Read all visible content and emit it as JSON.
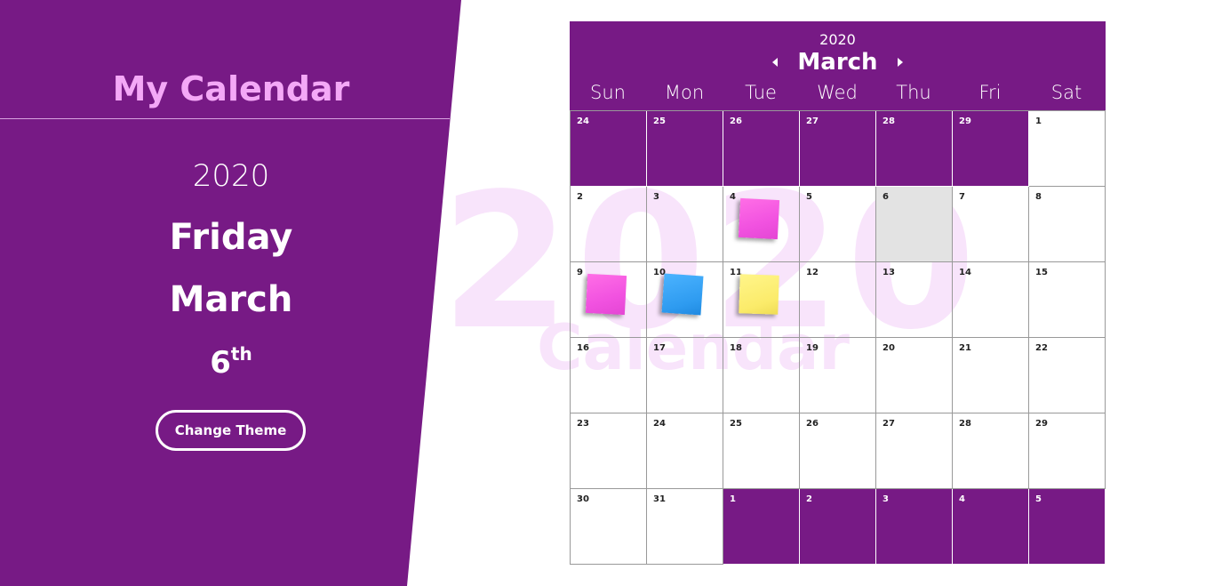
{
  "sidebar": {
    "title": "My Calendar",
    "year": "2020",
    "weekday": "Friday",
    "month": "March",
    "day": "6",
    "day_suffix": "th",
    "theme_button": "Change Theme"
  },
  "watermark": {
    "year": "2020",
    "subtitle": "Calendar"
  },
  "calendar": {
    "year": "2020",
    "month": "March",
    "weekdays": [
      "Sun",
      "Mon",
      "Tue",
      "Wed",
      "Thu",
      "Fri",
      "Sat"
    ],
    "days": [
      {
        "n": "24",
        "other": true
      },
      {
        "n": "25",
        "other": true
      },
      {
        "n": "26",
        "other": true
      },
      {
        "n": "27",
        "other": true
      },
      {
        "n": "28",
        "other": true
      },
      {
        "n": "29",
        "other": true
      },
      {
        "n": "1"
      },
      {
        "n": "2"
      },
      {
        "n": "3"
      },
      {
        "n": "4",
        "note": "pink"
      },
      {
        "n": "5"
      },
      {
        "n": "6",
        "today": true
      },
      {
        "n": "7"
      },
      {
        "n": "8"
      },
      {
        "n": "9",
        "note": "pink"
      },
      {
        "n": "10",
        "note": "blue"
      },
      {
        "n": "11",
        "note": "yellow"
      },
      {
        "n": "12"
      },
      {
        "n": "13"
      },
      {
        "n": "14"
      },
      {
        "n": "15"
      },
      {
        "n": "16"
      },
      {
        "n": "17"
      },
      {
        "n": "18"
      },
      {
        "n": "19"
      },
      {
        "n": "20"
      },
      {
        "n": "21"
      },
      {
        "n": "22"
      },
      {
        "n": "23"
      },
      {
        "n": "24"
      },
      {
        "n": "25"
      },
      {
        "n": "26"
      },
      {
        "n": "27"
      },
      {
        "n": "28"
      },
      {
        "n": "29"
      },
      {
        "n": "30"
      },
      {
        "n": "31"
      },
      {
        "n": "1",
        "other": true
      },
      {
        "n": "2",
        "other": true
      },
      {
        "n": "3",
        "other": true
      },
      {
        "n": "4",
        "other": true
      },
      {
        "n": "5",
        "other": true
      }
    ]
  },
  "colors": {
    "primary": "#771a85",
    "title_accent": "#f4a8f7",
    "watermark": "#f8e4fb",
    "today": "#e3e3e3",
    "note_pink": "#f152e0",
    "note_blue": "#2e9bf0",
    "note_yellow": "#fbeb6a"
  },
  "icons": {
    "prev": "caret-left-icon",
    "next": "caret-right-icon"
  }
}
